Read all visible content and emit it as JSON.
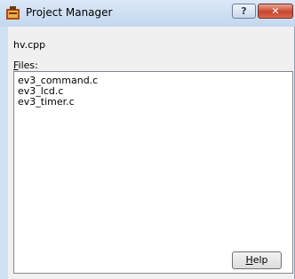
{
  "window": {
    "title": "Project Manager",
    "help_button_label": "?",
    "close_button_label": "✕"
  },
  "content": {
    "filename": "hv.cpp",
    "files_label_mnemonic": "F",
    "files_label_rest": "iles:",
    "files": [
      "ev3_command.c",
      "ev3_lcd.c",
      "ev3_timer.c"
    ]
  },
  "buttons": {
    "help_mnemonic": "H",
    "help_rest": "elp"
  },
  "colors": {
    "title_bar": "#c3d7ee",
    "close_button": "#c8452f",
    "dialog_background": "#f0f0f0"
  }
}
